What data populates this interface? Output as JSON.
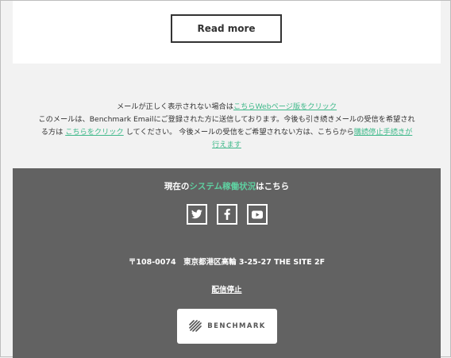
{
  "card": {
    "read_more_label": "Read more"
  },
  "notice": {
    "line1_prefix": "メールが正しく表示されない場合は",
    "line1_link": "こちらWebページ版をクリック",
    "line2": "このメールは、Benchmark Emailにご登録された方に送信しております。今後も引き続きメールの受信を希望され",
    "line3_prefix": "る方は ",
    "line3_link1": "こちらをクリック",
    "line3_middle": " してください。 今後メールの受信をご希望されない方は、こちらから",
    "line3_link2": "購読停止手続きが",
    "line4_link": "行えます",
    "link_color": "#3fb98a"
  },
  "footer": {
    "status_prefix": "現在の",
    "status_link": "システム稼働状況",
    "status_suffix": "はこちら",
    "social": [
      {
        "icon": "twitter-icon"
      },
      {
        "icon": "facebook-icon"
      },
      {
        "icon": "youtube-icon"
      }
    ],
    "address": "〒108-0074　東京都港区高輪 3-25-27 THE SITE 2F",
    "unsubscribe_label": "配信停止",
    "logo_text": "BENCHMARK",
    "background": "#626262",
    "accent": "#5fd0a1"
  }
}
